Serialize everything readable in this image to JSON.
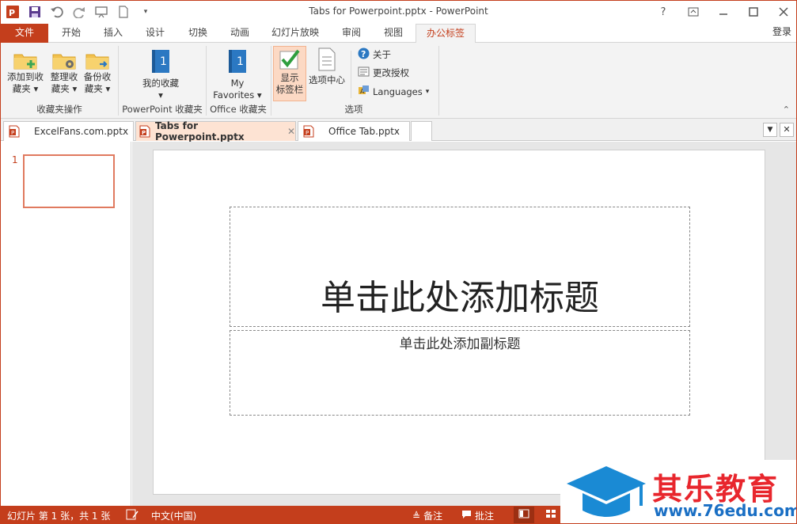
{
  "window": {
    "title": "Tabs for Powerpoint.pptx - PowerPoint",
    "help": "?",
    "signin": "登录"
  },
  "ribbon_tabs": [
    "文件",
    "开始",
    "插入",
    "设计",
    "切换",
    "动画",
    "幻灯片放映",
    "审阅",
    "视图",
    "办公标签"
  ],
  "ribbon": {
    "groups": {
      "favorites_ops": "收藏夹操作",
      "ppt_favorites": "PowerPoint 收藏夹",
      "office_favorites": "Office 收藏夹",
      "options": "选项"
    },
    "buttons": {
      "add_fav_1": "添加到收",
      "add_fav_2": "藏夹",
      "organize_1": "整理收",
      "organize_2": "藏夹",
      "backup_1": "备份收",
      "backup_2": "藏夹",
      "my_fav": "我的收藏",
      "my_favorites_1": "My",
      "my_favorites_2": "Favorites",
      "show_tabbar_1": "显示",
      "show_tabbar_2": "标签栏",
      "option_center": "选项中心",
      "about": "关于",
      "change_license": "更改授权",
      "languages": "Languages"
    }
  },
  "doc_tabs": [
    {
      "label": "ExcelFans.com.pptx",
      "active": false
    },
    {
      "label": "Tabs for Powerpoint.pptx",
      "active": true
    },
    {
      "label": "Office Tab.pptx",
      "active": false
    }
  ],
  "slides": {
    "thumb_number": "1"
  },
  "slide": {
    "title_placeholder": "单击此处添加标题",
    "subtitle_placeholder": "单击此处添加副标题"
  },
  "status": {
    "slide_info": "幻灯片 第 1 张，共 1 张",
    "language": "中文(中国)",
    "notes": "备注",
    "comments": "批注"
  },
  "watermark": {
    "text": "其乐教育",
    "url": "www.76edu.com"
  },
  "colors": {
    "accent": "#c43e1c",
    "active_tab_bg": "#fde3d3"
  }
}
